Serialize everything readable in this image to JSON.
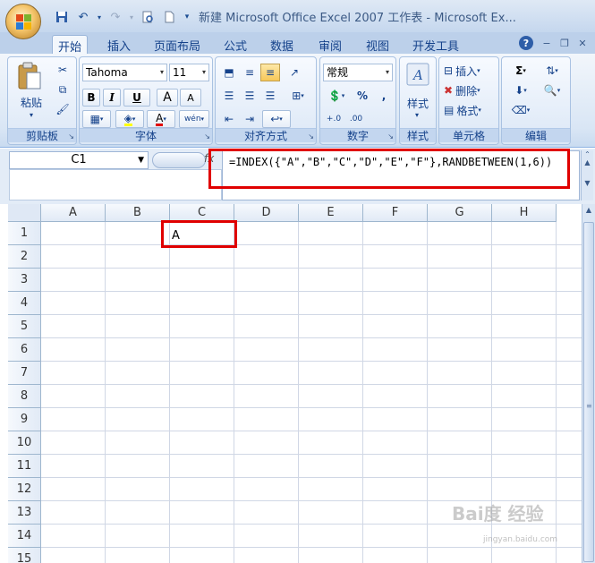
{
  "window": {
    "title": "新建 Microsoft Office Excel 2007 工作表 - Microsoft Ex..."
  },
  "tabs": [
    "开始",
    "插入",
    "页面布局",
    "公式",
    "数据",
    "审阅",
    "视图",
    "开发工具"
  ],
  "active_tab": "开始",
  "ribbon": {
    "clipboard": {
      "label": "剪贴板",
      "paste": "粘贴"
    },
    "font": {
      "label": "字体",
      "font_name": "Tahoma",
      "font_size": "11",
      "bold": "B",
      "italic": "I",
      "underline": "U",
      "grow": "A",
      "shrink": "A",
      "font_color": "A",
      "phonetic": "wén"
    },
    "alignment": {
      "label": "对齐方式"
    },
    "number": {
      "label": "数字",
      "format": "常规",
      "percent": "%",
      "comma": ","
    },
    "styles": {
      "label": "样式",
      "button": "样式"
    },
    "cells": {
      "label": "单元格",
      "insert": "插入",
      "delete": "删除",
      "format": "格式"
    },
    "editing": {
      "label": "编辑"
    }
  },
  "formula_bar": {
    "name_box": "C1",
    "fx": "fx",
    "formula": "=INDEX({\"A\",\"B\",\"C\",\"D\",\"E\",\"F\"},RANDBETWEEN(1,6))"
  },
  "sheet": {
    "columns": [
      "A",
      "B",
      "C",
      "D",
      "E",
      "F",
      "G",
      "H"
    ],
    "rows": [
      "1",
      "2",
      "3",
      "4",
      "5",
      "6",
      "7",
      "8",
      "9",
      "10",
      "11",
      "12",
      "13",
      "14",
      "15"
    ],
    "cell_C1": "A"
  },
  "watermark": {
    "text": "Bai度 经验",
    "sub": "jingyan.baidu.com"
  },
  "colors": {
    "highlight": "#e00000",
    "ribbon_text": "#15428b",
    "grid": "#d0d7e5"
  }
}
